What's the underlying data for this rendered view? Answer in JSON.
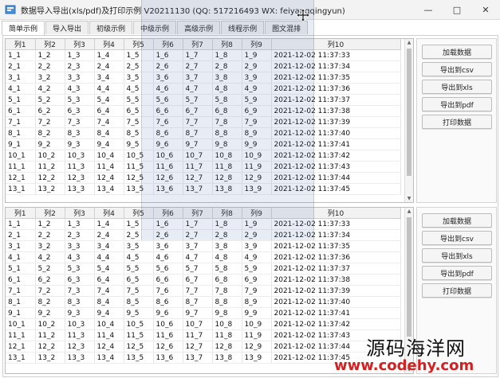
{
  "window": {
    "title": "数据导入导出(xls/pdf)及打印示例 V20211130 (QQ: 517216493 WX: feiyangqingyun)",
    "minimize_glyph": "—",
    "maximize_glyph": "□",
    "close_glyph": "✕"
  },
  "tabs": [
    {
      "label": "简单示例",
      "active": true
    },
    {
      "label": "导入导出",
      "active": false
    },
    {
      "label": "初级示例",
      "active": false
    },
    {
      "label": "中级示例",
      "active": false
    },
    {
      "label": "高级示例",
      "active": false
    },
    {
      "label": "线程示例",
      "active": false
    },
    {
      "label": "图文混排",
      "active": false
    }
  ],
  "table": {
    "columns": [
      "列1",
      "列2",
      "列3",
      "列4",
      "列5",
      "列6",
      "列7",
      "列8",
      "列9",
      "列10"
    ],
    "rows": [
      [
        "1_1",
        "1_2",
        "1_3",
        "1_4",
        "1_5",
        "1_6",
        "1_7",
        "1_8",
        "1_9",
        "2021-12-02 11:37:33"
      ],
      [
        "2_1",
        "2_2",
        "2_3",
        "2_4",
        "2_5",
        "2_6",
        "2_7",
        "2_8",
        "2_9",
        "2021-12-02 11:37:34"
      ],
      [
        "3_1",
        "3_2",
        "3_3",
        "3_4",
        "3_5",
        "3_6",
        "3_7",
        "3_8",
        "3_9",
        "2021-12-02 11:37:35"
      ],
      [
        "4_1",
        "4_2",
        "4_3",
        "4_4",
        "4_5",
        "4_6",
        "4_7",
        "4_8",
        "4_9",
        "2021-12-02 11:37:36"
      ],
      [
        "5_1",
        "5_2",
        "5_3",
        "5_4",
        "5_5",
        "5_6",
        "5_7",
        "5_8",
        "5_9",
        "2021-12-02 11:37:37"
      ],
      [
        "6_1",
        "6_2",
        "6_3",
        "6_4",
        "6_5",
        "6_6",
        "6_7",
        "6_8",
        "6_9",
        "2021-12-02 11:37:38"
      ],
      [
        "7_1",
        "7_2",
        "7_3",
        "7_4",
        "7_5",
        "7_6",
        "7_7",
        "7_8",
        "7_9",
        "2021-12-02 11:37:39"
      ],
      [
        "8_1",
        "8_2",
        "8_3",
        "8_4",
        "8_5",
        "8_6",
        "8_7",
        "8_8",
        "8_9",
        "2021-12-02 11:37:40"
      ],
      [
        "9_1",
        "9_2",
        "9_3",
        "9_4",
        "9_5",
        "9_6",
        "9_7",
        "9_8",
        "9_9",
        "2021-12-02 11:37:41"
      ],
      [
        "10_1",
        "10_2",
        "10_3",
        "10_4",
        "10_5",
        "10_6",
        "10_7",
        "10_8",
        "10_9",
        "2021-12-02 11:37:42"
      ],
      [
        "11_1",
        "11_2",
        "11_3",
        "11_4",
        "11_5",
        "11_6",
        "11_7",
        "11_8",
        "11_9",
        "2021-12-02 11:37:43"
      ],
      [
        "12_1",
        "12_2",
        "12_3",
        "12_4",
        "12_5",
        "12_6",
        "12_7",
        "12_8",
        "12_9",
        "2021-12-02 11:37:44"
      ],
      [
        "13_1",
        "13_2",
        "13_3",
        "13_4",
        "13_5",
        "13_6",
        "13_7",
        "13_8",
        "13_9",
        "2021-12-02 11:37:45"
      ]
    ]
  },
  "actions": {
    "load": "加载数据",
    "export_csv": "导出到csv",
    "export_xls": "导出到xls",
    "export_pdf": "导出到pdf",
    "print": "打印数据"
  },
  "watermark": {
    "brand": "源码海洋网",
    "url": "www.codehy.com"
  },
  "icons": {
    "app": "app-icon",
    "cursor": "move-cursor-icon"
  }
}
